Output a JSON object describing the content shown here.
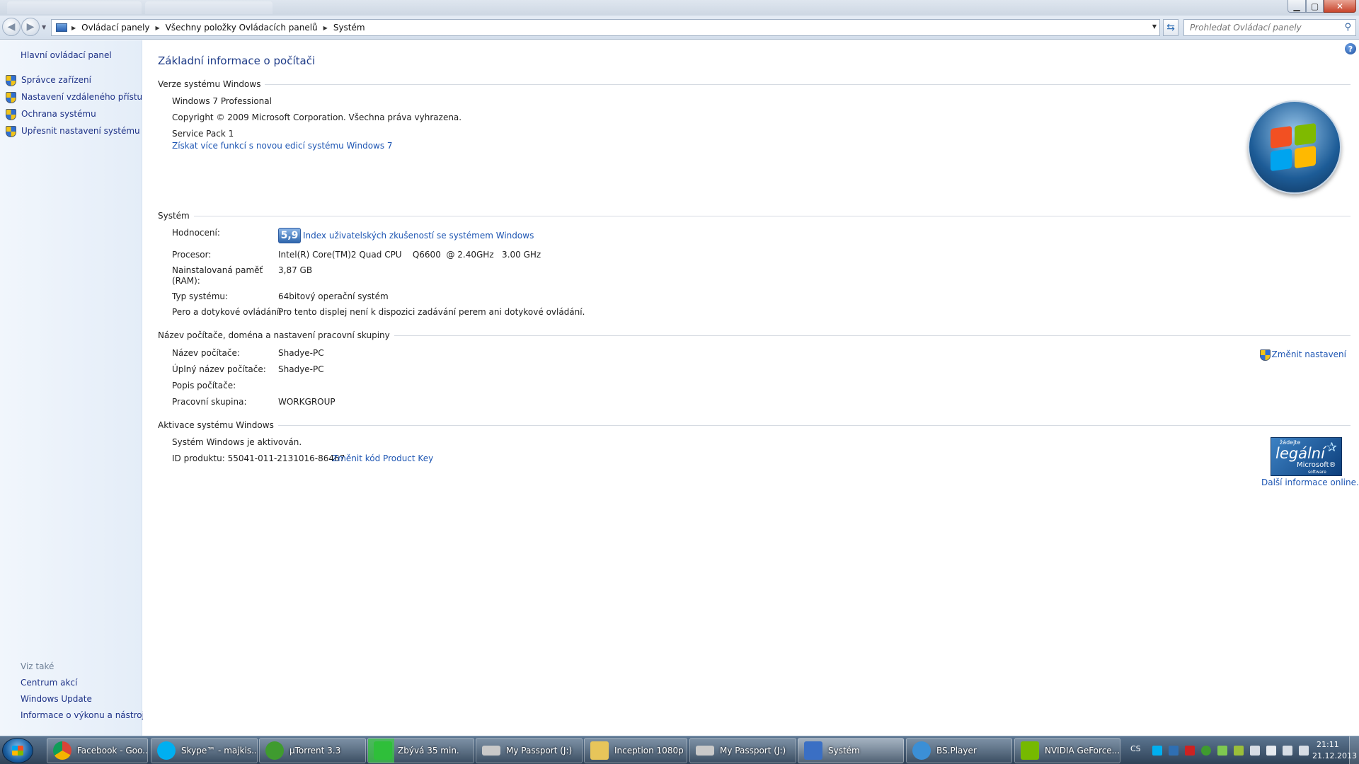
{
  "address_bar": {
    "breadcrumb": [
      "Ovládací panely",
      "Všechny položky Ovládacích panelů",
      "Systém"
    ],
    "search_placeholder": "Prohledat Ovládací panely"
  },
  "left_pane": {
    "home_link": "Hlavní ovládací panel",
    "tasks": [
      "Správce zařízení",
      "Nastavení vzdáleného přístupu",
      "Ochrana systému",
      "Upřesnit nastavení systému"
    ],
    "see_also_label": "Viz také",
    "see_also": [
      "Centrum akcí",
      "Windows Update",
      "Informace o výkonu a nástroje"
    ]
  },
  "main": {
    "title": "Základní informace o počítači",
    "windows_edition": {
      "heading": "Verze systému Windows",
      "edition": "Windows 7 Professional",
      "copyright": "Copyright © 2009 Microsoft Corporation. Všechna práva vyhrazena.",
      "service_pack": "Service Pack 1",
      "upgrade_link": "Získat více funkcí s novou edicí systému Windows 7"
    },
    "system": {
      "heading": "Systém",
      "rating_label": "Hodnocení:",
      "rating_score": "5,9",
      "rating_link": "Index uživatelských zkušeností se systémem Windows",
      "processor_label": "Procesor:",
      "processor_value": "Intel(R) Core(TM)2 Quad CPU    Q6600  @ 2.40GHz   3.00 GHz",
      "ram_label_1": "Nainstalovaná paměť",
      "ram_label_2": "(RAM):",
      "ram_value": "3,87 GB",
      "type_label": "Typ systému:",
      "type_value": "64bitový operační systém",
      "pen_label": "Pero a dotykové ovládání:",
      "pen_value": "Pro tento displej není k dispozici zadávání perem ani dotykové ovládání."
    },
    "computer_name": {
      "heading": "Název počítače, doména a nastavení pracovní skupiny",
      "name_label": "Název počítače:",
      "name_value": "Shadye-PC",
      "full_label": "Úplný název počítače:",
      "full_value": "Shadye-PC",
      "desc_label": "Popis počítače:",
      "desc_value": "",
      "workgroup_label": "Pracovní skupina:",
      "workgroup_value": "WORKGROUP",
      "change_link": "Změnit nastavení"
    },
    "activation": {
      "heading": "Aktivace systému Windows",
      "status": "Systém Windows je aktivován.",
      "product_id": "ID produktu: 55041-011-2131016-86467",
      "change_key_link": "Změnit kód Product Key",
      "badge_line1": "žádejte",
      "badge_line2": "legální",
      "badge_line3": "Microsoft®",
      "badge_line4": "software",
      "more_info_link": "Další informace online..."
    }
  },
  "taskbar": {
    "tasks": [
      {
        "label": "Facebook - Goo...",
        "icon": "chrome-icon",
        "color": "#d9412c"
      },
      {
        "label": "Skype™ - majkis...",
        "icon": "skype-icon",
        "color": "#00aff0"
      },
      {
        "label": "µTorrent 3.3",
        "icon": "utorrent-icon",
        "color": "#3f9b2f"
      },
      {
        "label": "Zbývá 35 min.",
        "icon": "copy-progress-icon",
        "color": "#2fbf3a"
      },
      {
        "label": "My Passport (J:)",
        "icon": "drive-icon",
        "color": "#c9c9c9"
      },
      {
        "label": "Inception 1080p",
        "icon": "folder-icon",
        "color": "#e7c55a"
      },
      {
        "label": "My Passport (J:)",
        "icon": "drive-icon",
        "color": "#c9c9c9"
      },
      {
        "label": "Systém",
        "icon": "system-icon",
        "color": "#3a6fc4"
      },
      {
        "label": "BS.Player",
        "icon": "bsplayer-icon",
        "color": "#3b8fd6"
      },
      {
        "label": "NVIDIA GeForce...",
        "icon": "nvidia-icon",
        "color": "#76b900"
      }
    ],
    "copy_progress": 0.25,
    "language": "CS",
    "time": "21:11",
    "date": "21.12.2013"
  }
}
